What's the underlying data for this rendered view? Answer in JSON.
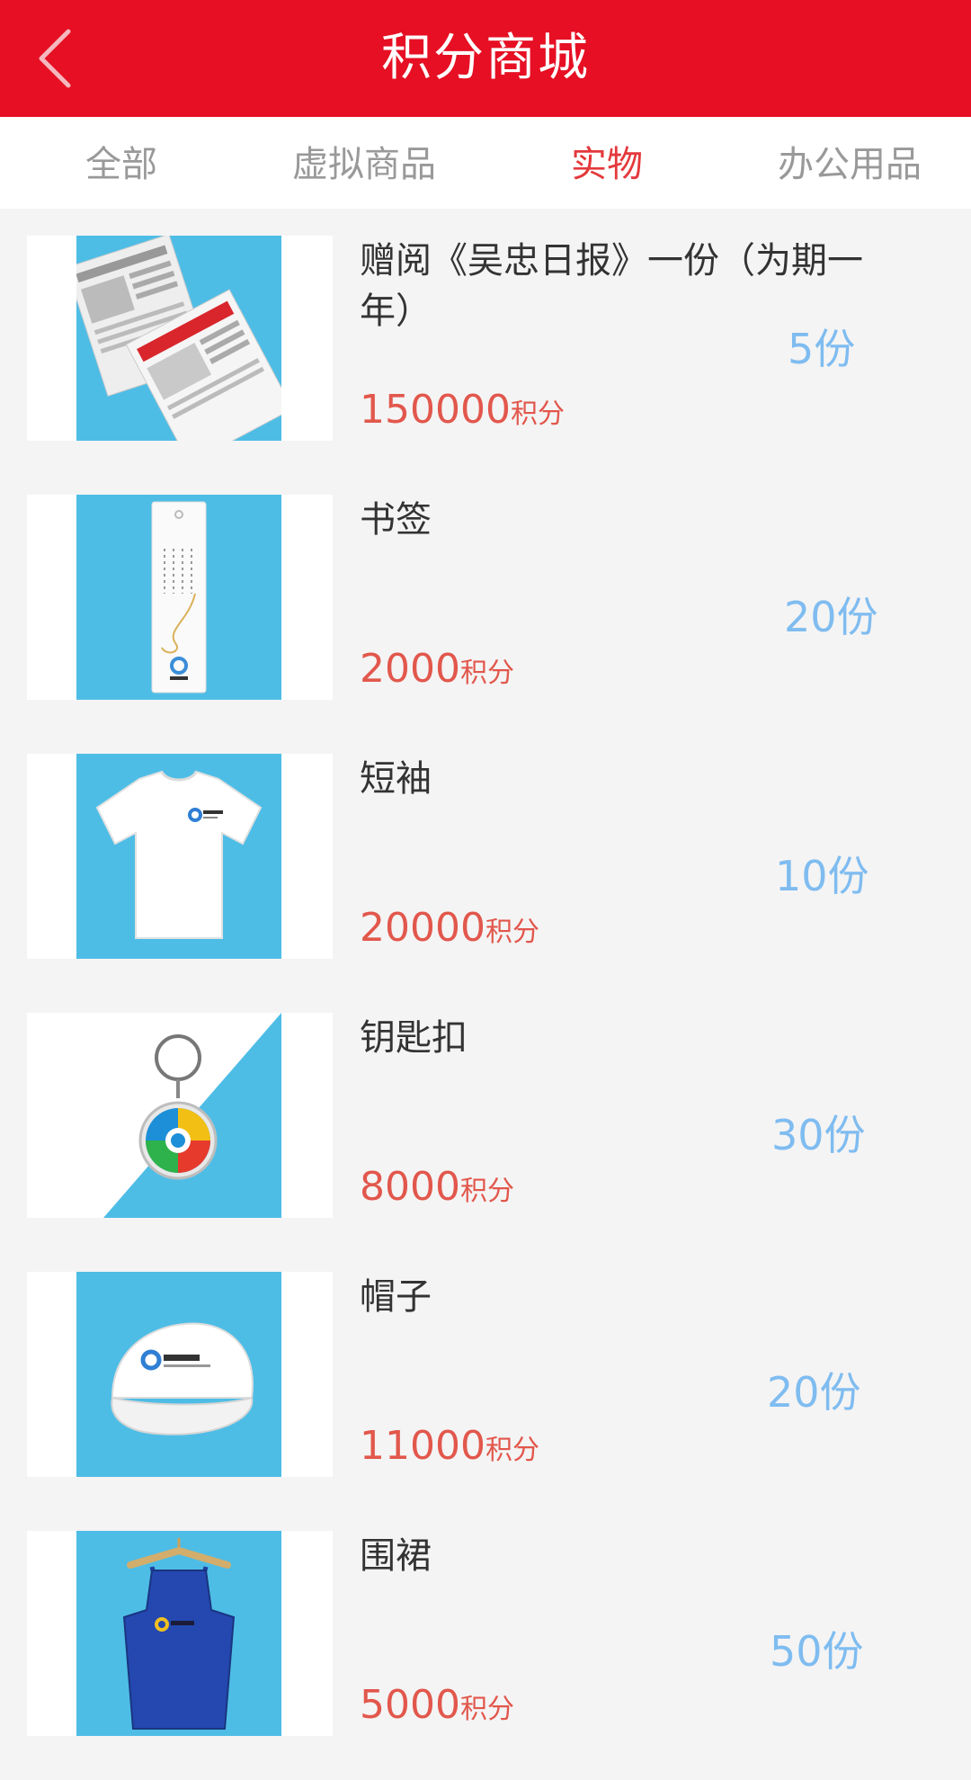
{
  "header": {
    "title": "积分商城"
  },
  "tabs": [
    {
      "label": "全部",
      "active": false
    },
    {
      "label": "虚拟商品",
      "active": false
    },
    {
      "label": "实物",
      "active": true
    },
    {
      "label": "办公用品",
      "active": false
    }
  ],
  "price_unit": "积分",
  "items": [
    {
      "name": "赠阅《吴忠日报》一份（为期一年）",
      "price": "150000",
      "quantity": "5份",
      "image": "newspaper-image"
    },
    {
      "name": "书签",
      "price": "2000",
      "quantity": "20份",
      "image": "bookmark-image"
    },
    {
      "name": "短袖",
      "price": "20000",
      "quantity": "10份",
      "image": "tshirt-image"
    },
    {
      "name": "钥匙扣",
      "price": "8000",
      "quantity": "30份",
      "image": "keychain-image"
    },
    {
      "name": "帽子",
      "price": "11000",
      "quantity": "20份",
      "image": "cap-image"
    },
    {
      "name": "围裙",
      "price": "5000",
      "quantity": "50份",
      "image": "apron-image"
    }
  ],
  "colors": {
    "header_bg": "#e60f23",
    "active_tab": "#e4393c",
    "price": "#e2574c",
    "quantity": "#7fbcf0",
    "thumb_bg": "#4ebde6"
  }
}
